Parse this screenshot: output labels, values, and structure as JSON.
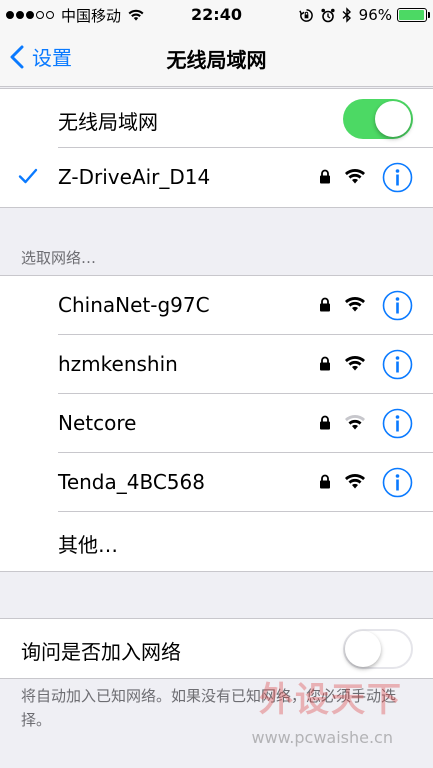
{
  "status_bar": {
    "carrier": "中国移动",
    "time": "22:40",
    "battery_percent": "96%",
    "battery_level": 0.96,
    "signal_bars_filled": 3,
    "signal_bars_total": 5
  },
  "nav": {
    "back_label": "设置",
    "title": "无线局域网"
  },
  "wifi_toggle": {
    "label": "无线局域网",
    "on": true
  },
  "connected_network": {
    "name": "Z-DriveAir_D14",
    "secured": true
  },
  "choose_network_header": "选取网络…",
  "networks": [
    {
      "name": "ChinaNet-g97C",
      "secured": true
    },
    {
      "name": "hzmkenshin",
      "secured": true
    },
    {
      "name": "Netcore",
      "secured": true
    },
    {
      "name": "Tenda_4BC568",
      "secured": true
    }
  ],
  "other_label": "其他…",
  "ask_to_join": {
    "label": "询问是否加入网络",
    "on": false
  },
  "footer_note": "将自动加入已知网络。如果没有已知网络，您必须手动选择。",
  "watermark": {
    "text": "外设天下",
    "url": "www.pcwaishe.cn"
  },
  "colors": {
    "accent": "#0a7aff",
    "toggle_on": "#4cd964",
    "background": "#efeff4"
  }
}
